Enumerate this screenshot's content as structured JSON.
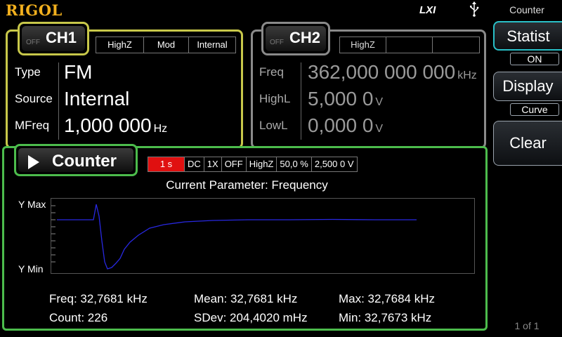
{
  "header": {
    "logo": "RIGOL",
    "lxi_label": "LXI",
    "usb_icon": "usb-icon"
  },
  "menu": {
    "title": "Counter",
    "statist_label": "Statist",
    "statist_value": "ON",
    "display_label": "Display",
    "display_value": "Curve",
    "clear_label": "Clear",
    "page": "1 of 1"
  },
  "ch1": {
    "off": "OFF",
    "name": "CH1",
    "flags": [
      "HighZ",
      "Mod",
      "Internal"
    ],
    "params": [
      {
        "label": "Type",
        "value": "FM",
        "unit": ""
      },
      {
        "label": "Source",
        "value": "Internal",
        "unit": ""
      },
      {
        "label": "MFreq",
        "value": "1,000 000",
        "unit": "Hz"
      }
    ],
    "color": "#c8c84a"
  },
  "ch2": {
    "off": "OFF",
    "name": "CH2",
    "flags": [
      "HighZ",
      "",
      ""
    ],
    "params": [
      {
        "label": "Freq",
        "value": "362,000 000 000",
        "unit": "kHz"
      },
      {
        "label": "HighL",
        "value": "5,000 0",
        "unit": "V"
      },
      {
        "label": "LowL",
        "value": "0,000 0",
        "unit": "V"
      }
    ],
    "color": "#8a8a8a"
  },
  "counter": {
    "title": "Counter",
    "settings": {
      "gate": "1 s",
      "coupling": "DC",
      "attenuation": "1X",
      "filter": "OFF",
      "impedance": "HighZ",
      "duty": "50,0 %",
      "level": "2,500 0 V"
    },
    "current_parameter": "Current Parameter: Frequency",
    "y_max_label": "Y Max",
    "y_min_label": "Y Min",
    "trace_color": "#2828e0",
    "stats": {
      "freq": "Freq: 32,7681 kHz",
      "count": "Count: 226",
      "mean": "Mean: 32,7681 kHz",
      "sdev": "SDev: 204,4020 mHz",
      "max": "Max: 32,7684 kHz",
      "min": "Min: 32,7673 kHz"
    }
  },
  "colors": {
    "ch1": "#c8c84a",
    "ch2": "#8a8a8a",
    "counter": "#4cbc4c",
    "active_menu": "#29c0c8",
    "gate_highlight": "#e01010",
    "logo": "#f2b01e"
  }
}
